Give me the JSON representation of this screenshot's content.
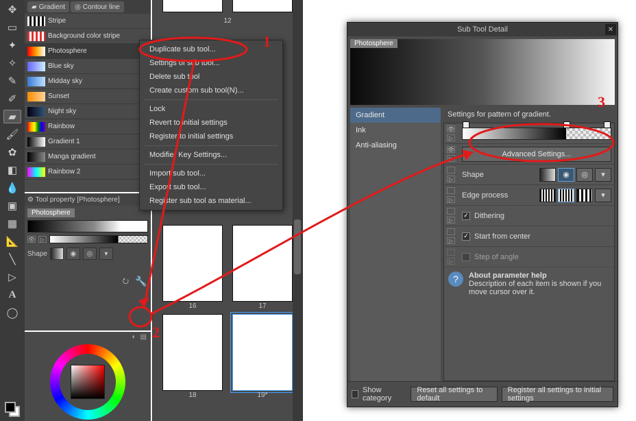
{
  "tooltabs": {
    "gradient": "Gradient",
    "contour": "Contour line"
  },
  "subtools": [
    {
      "label": "Stripe"
    },
    {
      "label": "Background color stripe"
    },
    {
      "label": "Photosphere"
    },
    {
      "label": "Blue sky"
    },
    {
      "label": "Midday sky"
    },
    {
      "label": "Sunset"
    },
    {
      "label": "Night sky"
    },
    {
      "label": "Rainbow"
    },
    {
      "label": "Gradient 1"
    },
    {
      "label": "Manga gradient"
    },
    {
      "label": "Rainbow 2"
    }
  ],
  "toolprop": {
    "header": "Tool property [Photosphere]",
    "tag": "Photosphere",
    "shape_label": "Shape"
  },
  "colorwheel": {
    "left_icon": "◐",
    "right_icon": "▤"
  },
  "thumbs": {
    "p12": "12",
    "p16": "16",
    "p17": "17",
    "p18": "18",
    "p19": "19*"
  },
  "ctx": {
    "duplicate": "Duplicate sub tool...",
    "settings": "Settings of sub tool...",
    "delete": "Delete sub tool",
    "custom": "Create custom sub tool(N)...",
    "lock": "Lock",
    "revert": "Revert to initial settings",
    "register": "Register to initial settings",
    "modkey": "Modifier Key Settings...",
    "import": "Import sub tool...",
    "export": "Export sub tool...",
    "material": "Register sub tool as material..."
  },
  "dlg": {
    "title": "Sub Tool Detail",
    "tag": "Photosphere",
    "cats": {
      "gradient": "Gradient",
      "ink": "Ink",
      "aa": "Anti-aliasing"
    },
    "desc": "Settings for pattern of gradient.",
    "advanced": "Advanced Settings...",
    "shape": "Shape",
    "edge": "Edge process",
    "dither": "Dithering",
    "center": "Start from center",
    "step": "Step of angle",
    "help_title": "About parameter help",
    "help_body": "Description of each item is shown if you move cursor over it.",
    "showcat": "Show category",
    "reset": "Reset all settings to default",
    "reginit": "Register all settings to initial settings"
  },
  "ann": {
    "n1": "1",
    "n2": "2",
    "n3": "3"
  }
}
